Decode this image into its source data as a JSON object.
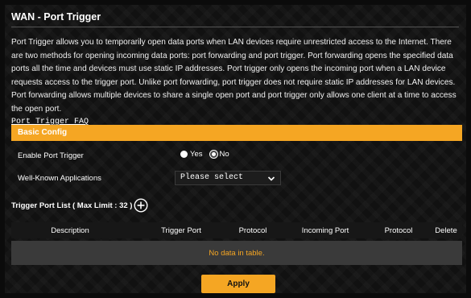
{
  "page": {
    "title": "WAN - Port Trigger",
    "description": "Port Trigger allows you to temporarily open data ports when LAN devices require unrestricted access to the Internet. There are two methods for opening incoming data ports: port forwarding and port trigger. Port forwarding opens the specified data ports all the time and devices must use static IP addresses. Port trigger only opens the incoming port when a LAN device requests access to the trigger port. Unlike port forwarding, port trigger does not require static IP addresses for LAN devices. Port forwarding allows multiple devices to share a single open port and port trigger only allows one client at a time to access the open port.",
    "faq_link": "Port Trigger FAQ"
  },
  "basic_config": {
    "header": "Basic Config",
    "enable_label": "Enable Port Trigger",
    "yes_label": "Yes",
    "no_label": "No",
    "enable_selected": "Yes",
    "apps_label": "Well-Known Applications",
    "apps_value": "Please select"
  },
  "trigger_list": {
    "title": "Trigger Port List ( Max Limit : 32 )",
    "columns": [
      "Description",
      "Trigger Port",
      "Protocol",
      "Incoming Port",
      "Protocol",
      "Delete"
    ],
    "empty_text": "No data in table."
  },
  "apply_label": "Apply",
  "colors": {
    "accent": "#f5a623",
    "background": "#111111",
    "empty_row": "#3a3a3a"
  },
  "icons": {
    "add": "plus-circle-icon",
    "dropdown": "chevron-down-icon"
  }
}
